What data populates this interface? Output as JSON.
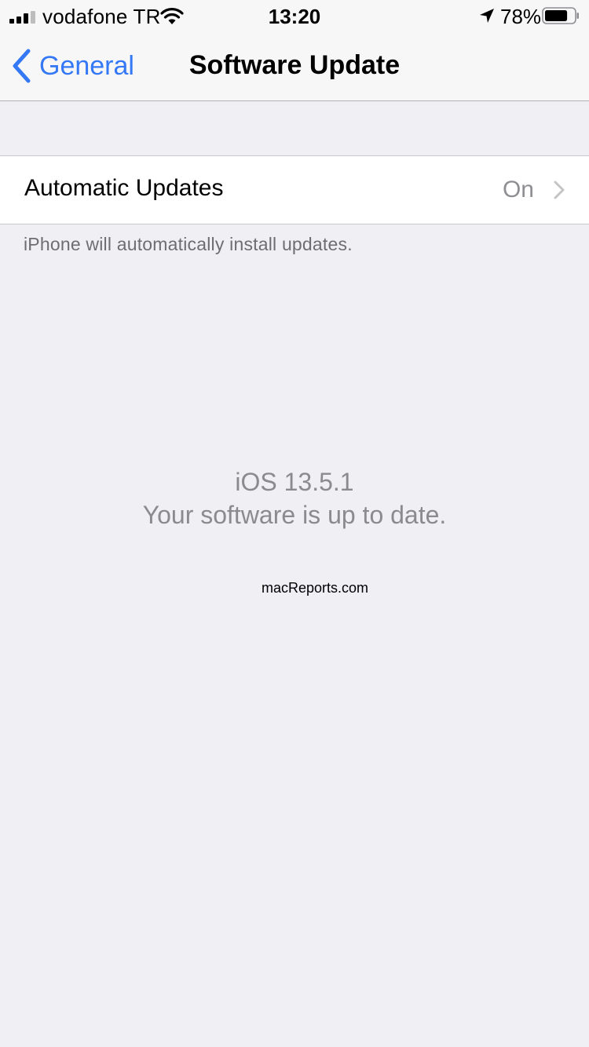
{
  "status_bar": {
    "carrier": "vodafone TR",
    "time": "13:20",
    "battery_percent": "78%",
    "battery_level": 0.78,
    "icons": [
      "signal-icon",
      "wifi-icon",
      "location-arrow-icon",
      "battery-icon"
    ]
  },
  "nav": {
    "back_label": "General",
    "title": "Software Update",
    "accent_color": "#3478f6"
  },
  "settings": {
    "automatic_updates_label": "Automatic Updates",
    "automatic_updates_value": "On",
    "footer_note": "iPhone will automatically install updates."
  },
  "update_status": {
    "version": "iOS 13.5.1",
    "message": "Your software is up to date."
  },
  "watermark": "macReports.com"
}
